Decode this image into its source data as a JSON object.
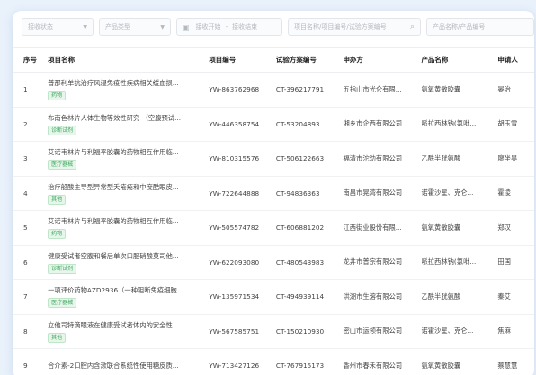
{
  "filters": {
    "status": "接收状态",
    "product_type": "产品类型",
    "date_start": "接收开始",
    "date_sep": "-",
    "date_end": "接收结束",
    "project_search": "项目名称/项目编号/试验方案编号",
    "product_search": "产品名称/产品编号"
  },
  "columns": {
    "idx": "序号",
    "name": "项目名称",
    "code": "项目编号",
    "scheme": "试验方案编号",
    "applicant": "申办方",
    "product": "产品名称",
    "person": "申请人"
  },
  "rows": [
    {
      "idx": "1",
      "name": "普那利单抗治疗风湿免疫性疾病相关缓血损...",
      "tag": "药物",
      "code": "YW-863762968",
      "scheme": "CT-396217791",
      "applicant": "五指山市光仑有限...",
      "product": "氨氧黄敏胶囊",
      "person": "晏治"
    },
    {
      "idx": "2",
      "name": "布南色林片人体生物等效性研究 （空腹预试...",
      "tag": "诊断试剂",
      "code": "YW-446358754",
      "scheme": "CT-53204893",
      "applicant": "湘乡市企西有限公司",
      "product": "哌拉西林钠(氯吡...",
      "person": "胡玉雪"
    },
    {
      "idx": "3",
      "name": "艾诺韦林片与利福平胶囊的药物相互作用临...",
      "tag": "医疗器械",
      "code": "YW-810315576",
      "scheme": "CT-506122663",
      "applicant": "福清市沱劝有限公司",
      "product": "乙酰半胱氨酸",
      "person": "廖坐昊"
    },
    {
      "idx": "4",
      "name": "治疗船酸主导型异常型夭疮疮和中度酷眼皮...",
      "tag": "其他",
      "code": "YW-722644888",
      "scheme": "CT-94836363",
      "applicant": "南昌市晃湾有限公司",
      "product": "诺霍沙星、克仑...",
      "person": "霍凌"
    },
    {
      "idx": "5",
      "name": "艾诺韦林片与利福平胶囊的药物相互作用临...",
      "tag": "药物",
      "code": "YW-505574782",
      "scheme": "CT-606881202",
      "applicant": "江西街业股份有限...",
      "product": "氨氧黄敏胶囊",
      "person": "郑汉"
    },
    {
      "idx": "6",
      "name": "健康受试者空腹和餐后单次口服硝酸莫司他...",
      "tag": "诊断试剂",
      "code": "YW-622093080",
      "scheme": "CT-480543983",
      "applicant": "龙井市普宗有限公司",
      "product": "哌拉西林钠(氯吡...",
      "person": "田国"
    },
    {
      "idx": "7",
      "name": "一项评价药物AZD2936（一种阻断免疫细胞...",
      "tag": "医疗器械",
      "code": "YW-135971534",
      "scheme": "CT-494939114",
      "applicant": "洪湖市生溶有限公司",
      "product": "乙酰半胱氨酸",
      "person": "秦艾"
    },
    {
      "idx": "8",
      "name": "立他司特滴眼液在健康受试者体内的安全性...",
      "tag": "其他",
      "code": "YW-567585751",
      "scheme": "CT-150210930",
      "applicant": "密山市运领有限公司",
      "product": "诺霍沙星、克仑...",
      "person": "焦麻"
    },
    {
      "idx": "9",
      "name": "合介素-2口腔内含漱联合系统性使用糖皮质...",
      "tag": "",
      "code": "YW-713427126",
      "scheme": "CT-767915173",
      "applicant": "香州市春禾有限公司",
      "product": "氨氧黄敏胶囊",
      "person": "蔡慧慧"
    }
  ]
}
